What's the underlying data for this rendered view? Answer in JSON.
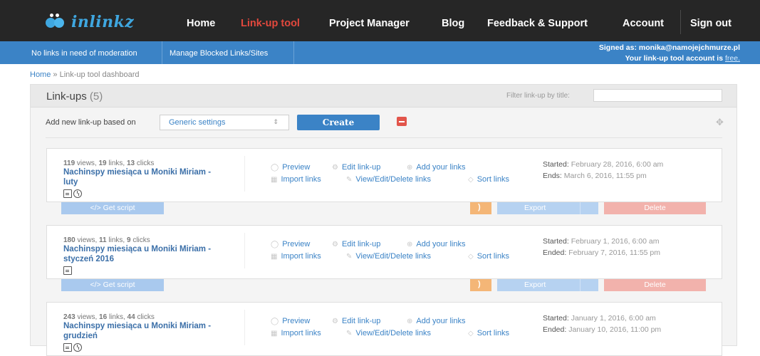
{
  "nav": {
    "logo_text": "inlinkz",
    "items": [
      "Home",
      "Link-up tool",
      "Project Manager",
      "Blog",
      "Feedback & Support",
      "Account",
      "Sign out"
    ],
    "active": "Link-up tool",
    "active_color": "#e2483d"
  },
  "subbar": {
    "items": [
      "No links in need of moderation",
      "Manage Blocked Links/Sites"
    ],
    "signed_as": "Signed as: monika@namojejchmurze.pl",
    "account_prefix": "Your link-up tool account is",
    "account_type": "free."
  },
  "breadcrumb": {
    "home": "Home",
    "sep": "»",
    "current": "Link-up tool dashboard"
  },
  "panel": {
    "title": "Link-ups",
    "count": "(5)",
    "filter_label": "Filter link-up by title:",
    "filter_value": "",
    "add_label": "Add new link-up based on",
    "select_value": "Generic settings",
    "create_label": "Create"
  },
  "actions": {
    "preview": "Preview",
    "edit": "Edit link-up",
    "add": "Add your links",
    "import": "Import links",
    "view": "View/Edit/Delete links",
    "sort": "Sort links"
  },
  "buttons": {
    "get_script": "Get script",
    "export": "Export",
    "delete": "Delete"
  },
  "linkups": [
    {
      "stats_views": "119",
      "stats_links": "19",
      "stats_clicks": "13",
      "name": "Nachinspy miesiąca u Moniki Miriam - luty",
      "started_label": "Started:",
      "started": "February 28, 2016, 6:00 am",
      "ended_label": "Ends:",
      "ended": "March 6, 2016, 11:55 pm"
    },
    {
      "stats_views": "180",
      "stats_links": "11",
      "stats_clicks": "9",
      "name": "Nachinspy miesiąca u Moniki Miriam - styczeń 2016",
      "started_label": "Started:",
      "started": "February 1, 2016, 6:00 am",
      "ended_label": "Ended:",
      "ended": "February 7, 2016, 11:55 pm"
    },
    {
      "stats_views": "243",
      "stats_links": "16",
      "stats_clicks": "44",
      "name": "Nachinspy miesiąca u Moniki Miriam - grudzień",
      "started_label": "Started:",
      "started": "January 1, 2016, 6:00 am",
      "ended_label": "Ended:",
      "ended": "January 10, 2016, 11:00 pm"
    }
  ],
  "labels": {
    "views": "views,",
    "links": "links,",
    "clicks": "clicks"
  }
}
